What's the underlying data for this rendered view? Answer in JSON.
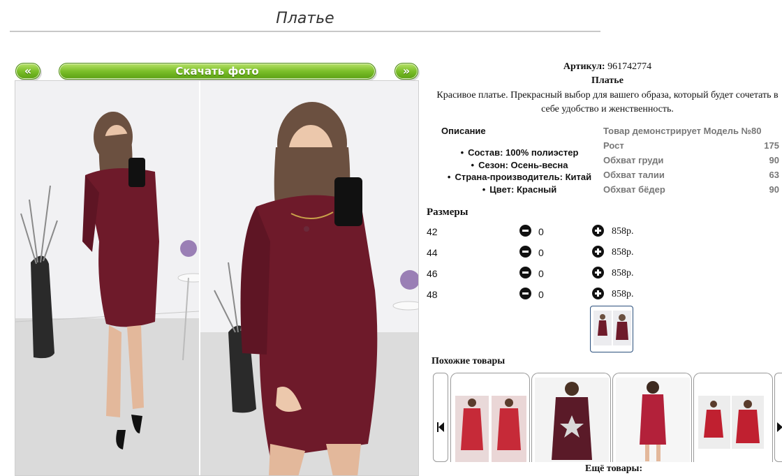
{
  "page": {
    "title": "Платье"
  },
  "photo_toolbar": {
    "prev_label": "«",
    "download_label": "Скачать фото",
    "next_label": "»"
  },
  "product": {
    "sku_label": "Артикул:",
    "sku_value": "961742774",
    "name": "Платье",
    "description": "Красивое платье. Прекрасный выбор для вашего образа, который будет сочетать в себе удобство и женственность."
  },
  "specs": {
    "title": "Описание",
    "items": [
      "Состав: 100% полиэстер",
      "Сезон: Осень-весна",
      "Страна-производитель: Китай",
      "Цвет: Красный"
    ]
  },
  "model": {
    "heading": "Товар демонстрирует Модель №80",
    "rows": [
      {
        "label": "Рост",
        "value": "175"
      },
      {
        "label": "Обхват груди",
        "value": "90"
      },
      {
        "label": "Обхват талии",
        "value": "63"
      },
      {
        "label": "Обхват бёдер",
        "value": "90"
      }
    ]
  },
  "sizes": {
    "title": "Размеры",
    "rows": [
      {
        "size": "42",
        "qty": "0",
        "price": "858р."
      },
      {
        "size": "44",
        "qty": "0",
        "price": "858р."
      },
      {
        "size": "46",
        "qty": "0",
        "price": "858р."
      },
      {
        "size": "48",
        "qty": "0",
        "price": "858р."
      }
    ]
  },
  "similar": {
    "title": "Похожие товары",
    "more_label": "Ещё товары:"
  },
  "colors": {
    "accent_green": "#7cbf2a",
    "dress_burgundy": "#6e1a2a",
    "thumb_border": "#2a4f7c"
  }
}
